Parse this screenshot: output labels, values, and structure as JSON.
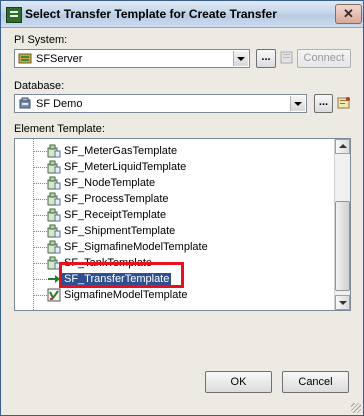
{
  "window": {
    "title": "Select Transfer Template for Create Transfer",
    "close_glyph": "✕"
  },
  "pi_system": {
    "label": "PI System:",
    "value": "SFServer",
    "connect_label": "Connect",
    "browse_label": "..."
  },
  "database": {
    "label": "Database:",
    "value": "SF Demo",
    "browse_label": "..."
  },
  "element_template": {
    "label": "Element Template:",
    "items": [
      {
        "label": "SF_MeterGasTemplate",
        "icon": "template-icon"
      },
      {
        "label": "SF_MeterLiquidTemplate",
        "icon": "template-icon"
      },
      {
        "label": "SF_NodeTemplate",
        "icon": "template-icon"
      },
      {
        "label": "SF_ProcessTemplate",
        "icon": "template-icon"
      },
      {
        "label": "SF_ReceiptTemplate",
        "icon": "template-icon"
      },
      {
        "label": "SF_ShipmentTemplate",
        "icon": "template-icon"
      },
      {
        "label": "SF_SigmafineModelTemplate",
        "icon": "template-icon"
      },
      {
        "label": "SF_TankTemplate",
        "icon": "template-icon"
      },
      {
        "label": "SF_TransferTemplate",
        "icon": "transfer-icon",
        "selected": true
      },
      {
        "label": "SigmafineModelTemplate",
        "icon": "model-template-icon"
      }
    ]
  },
  "buttons": {
    "ok": "OK",
    "cancel": "Cancel"
  },
  "colors": {
    "highlight": "#e8101c",
    "selection": "#2f4f8f"
  }
}
